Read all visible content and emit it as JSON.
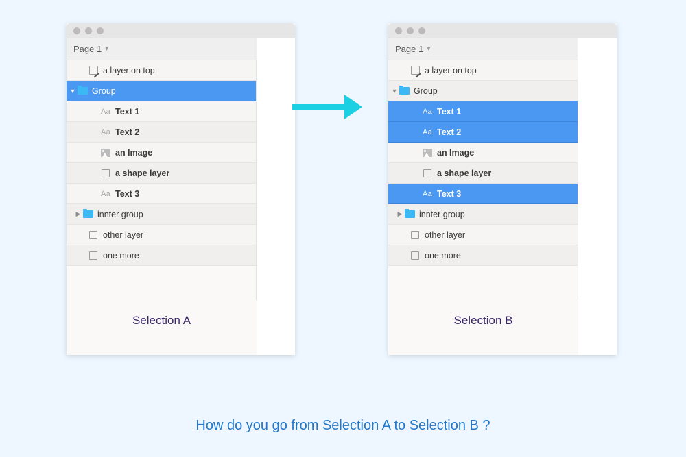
{
  "panelA": {
    "pageLabel": "Page 1",
    "caption": "Selection A",
    "rows": [
      {
        "kind": "art",
        "label": "a layer on top",
        "indent": 1,
        "sel": false
      },
      {
        "kind": "folder",
        "label": "Group",
        "indent": 0,
        "sel": true,
        "disc": "down"
      },
      {
        "kind": "text",
        "label": "Text 1",
        "indent": 2,
        "sel": false
      },
      {
        "kind": "text",
        "label": "Text 2",
        "indent": 2,
        "sel": false
      },
      {
        "kind": "image",
        "label": "an Image",
        "indent": 2,
        "sel": false
      },
      {
        "kind": "shape",
        "label": "a shape layer",
        "indent": 2,
        "sel": false
      },
      {
        "kind": "text",
        "label": "Text 3",
        "indent": 2,
        "sel": false
      },
      {
        "kind": "folder",
        "label": "innter group",
        "indent": 1,
        "sel": false,
        "disc": "right"
      },
      {
        "kind": "shape",
        "label": "other layer",
        "indent": 1,
        "sel": false
      },
      {
        "kind": "shape",
        "label": "one more",
        "indent": 1,
        "sel": false
      }
    ]
  },
  "panelB": {
    "pageLabel": "Page 1",
    "caption": "Selection B",
    "rows": [
      {
        "kind": "art",
        "label": "a layer on top",
        "indent": 1,
        "sel": false
      },
      {
        "kind": "folder",
        "label": "Group",
        "indent": 0,
        "sel": false,
        "disc": "down"
      },
      {
        "kind": "text",
        "label": "Text 1",
        "indent": 2,
        "sel": true
      },
      {
        "kind": "text",
        "label": "Text 2",
        "indent": 2,
        "sel": true
      },
      {
        "kind": "image",
        "label": "an Image",
        "indent": 2,
        "sel": false
      },
      {
        "kind": "shape",
        "label": "a shape layer",
        "indent": 2,
        "sel": false
      },
      {
        "kind": "text",
        "label": "Text 3",
        "indent": 2,
        "sel": true
      },
      {
        "kind": "folder",
        "label": "innter group",
        "indent": 1,
        "sel": false,
        "disc": "right"
      },
      {
        "kind": "shape",
        "label": "other layer",
        "indent": 1,
        "sel": false
      },
      {
        "kind": "shape",
        "label": "one more",
        "indent": 1,
        "sel": false
      }
    ]
  },
  "question": "How do you go from Selection A to Selection B ?"
}
